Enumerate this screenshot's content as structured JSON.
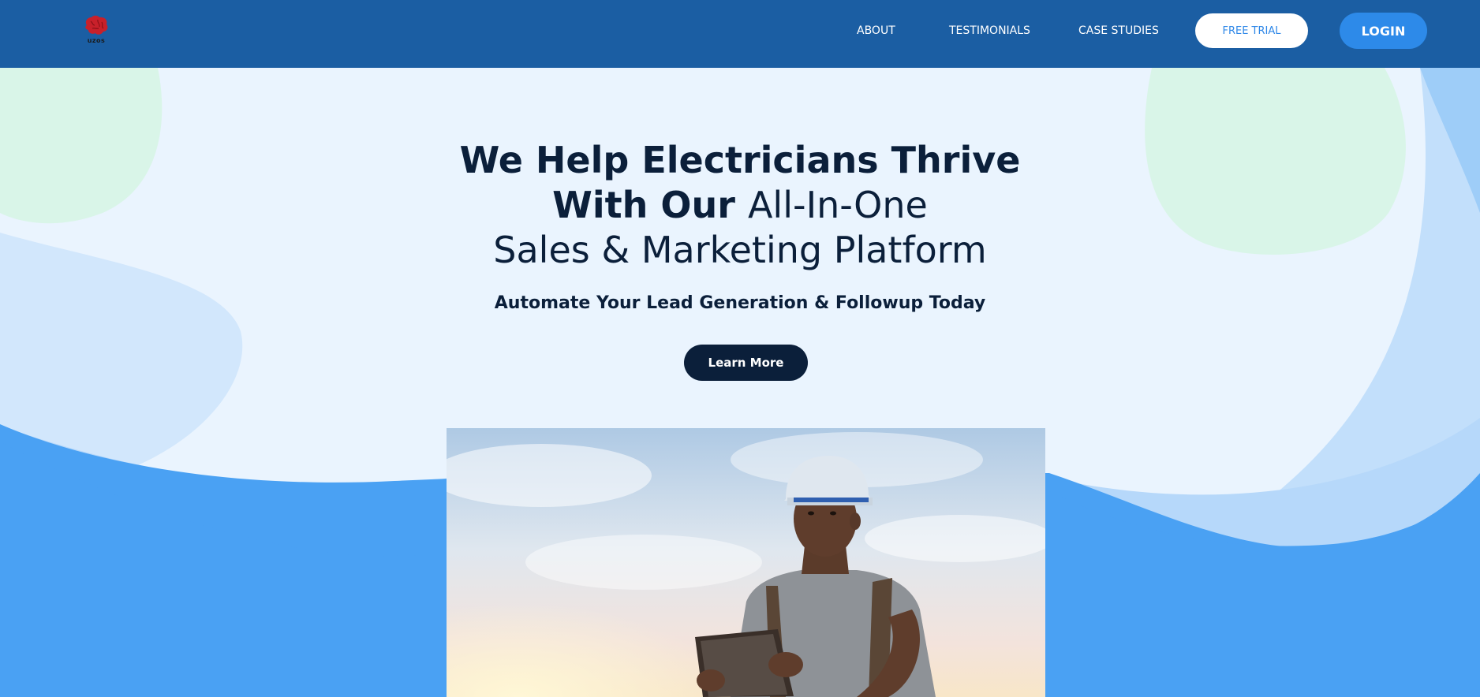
{
  "header": {
    "logo_text": "uzos",
    "nav": {
      "about": "ABOUT",
      "testimonials": "TESTIMONIALS",
      "case_studies": "CASE STUDIES"
    },
    "free_trial_label": "FREE TRIAL",
    "login_label": "LOGIN"
  },
  "hero": {
    "heading_line1": "We Help Electricians Thrive",
    "heading_line2_bold": "With Our",
    "heading_line2_light": "All-In-One",
    "heading_line3": "Sales & Marketing Platform",
    "subheading": "Automate Your Lead Generation & Followup Today",
    "cta_label": "Learn More"
  },
  "icons": {
    "logo": "brain-logo-icon"
  },
  "colors": {
    "navbar": "#1b5ea3",
    "page_background": "#eaf4fe",
    "wave_blue": "#4aa1f3",
    "heading_text": "#0b1f3a",
    "login_button": "#2d8ae9",
    "free_trial_text": "#2f88e8",
    "cta_button": "#0b1f3a",
    "logo_red": "#c8202a"
  }
}
